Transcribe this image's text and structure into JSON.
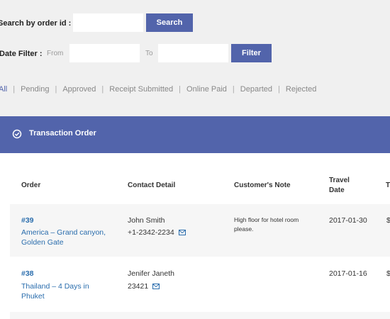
{
  "search": {
    "label": "Search by order id :",
    "button": "Search"
  },
  "date_filter": {
    "label": "Date Filter :",
    "from_label": "From",
    "to_label": "To",
    "button": "Filter"
  },
  "status_filters": [
    "All",
    "Pending",
    "Approved",
    "Receipt Submitted",
    "Online Paid",
    "Departed",
    "Rejected"
  ],
  "panel": {
    "title": "Transaction Order"
  },
  "table": {
    "headers": {
      "order": "Order",
      "contact": "Contact Detail",
      "note": "Customer's Note",
      "travel_line1": "Travel",
      "travel_line2": "Date",
      "total_partial": "T"
    },
    "rows": [
      {
        "id": "#39",
        "title_line1": "America – Grand canyon,",
        "title_line2": "Golden Gate",
        "name": "John Smith",
        "phone": "+1-2342-2234",
        "note_line1": "High floor for hotel room",
        "note_line2": "please.",
        "date": "2017-01-30",
        "total_partial": "$"
      },
      {
        "id": "#38",
        "title_line1": "Thailand – 4 Days in",
        "title_line2": "Phuket",
        "name": "Jenifer Janeth",
        "phone": "23421",
        "note_line1": "",
        "note_line2": "",
        "date": "2017-01-16",
        "total_partial": "$"
      }
    ]
  },
  "colors": {
    "accent": "#5264ab",
    "link": "#2a6dad",
    "page_bg": "#f0f0f0"
  },
  "icons": {
    "panel": "check-circle-icon",
    "contact": "envelope-icon"
  }
}
